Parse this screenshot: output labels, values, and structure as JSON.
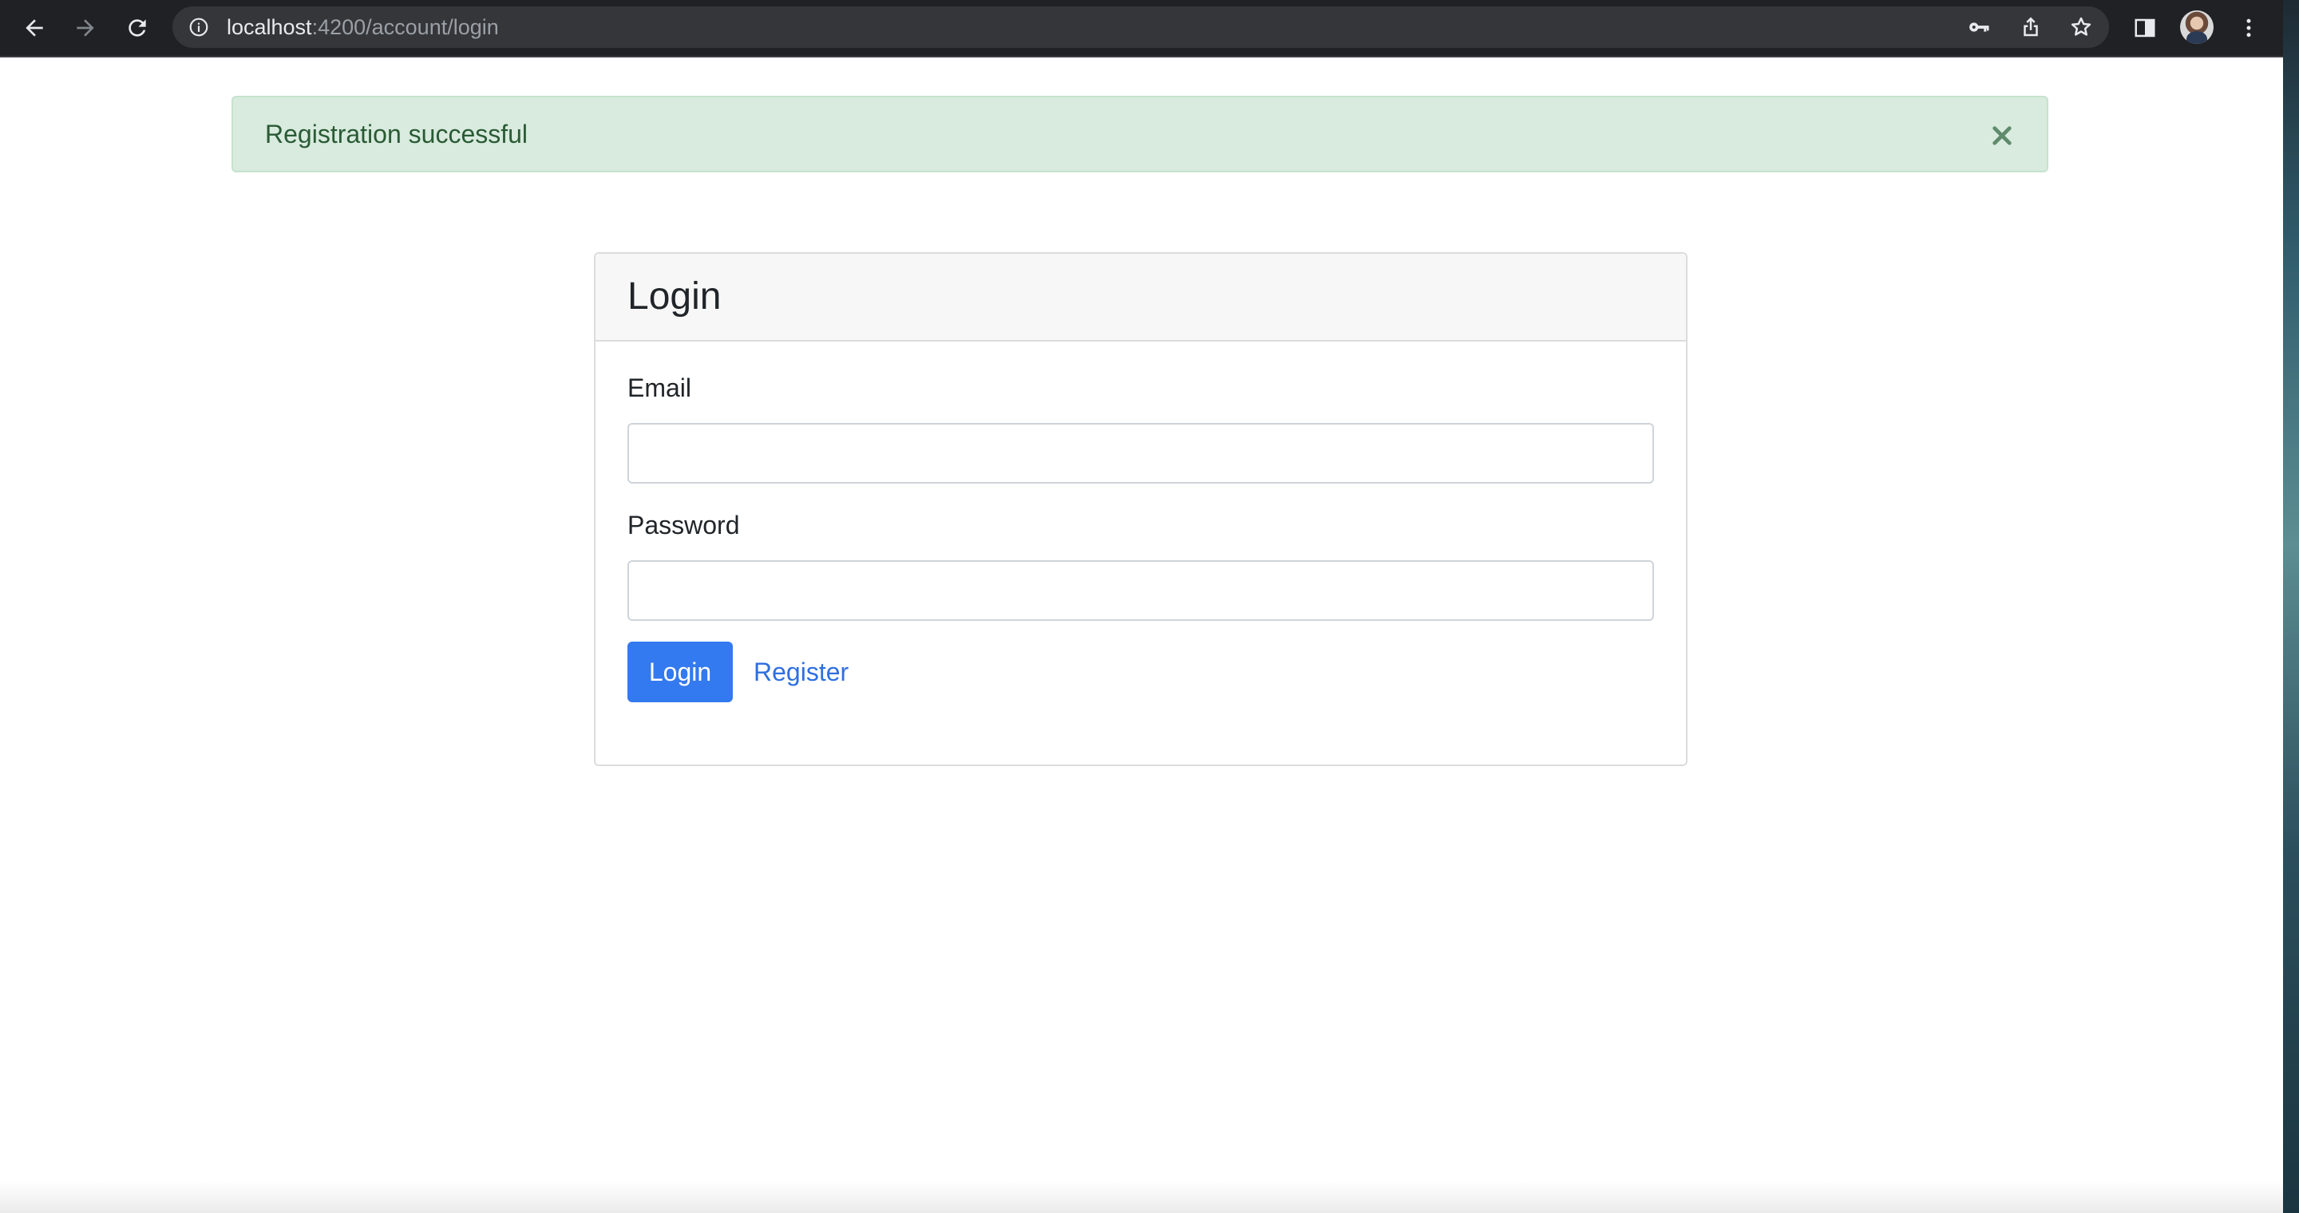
{
  "browser": {
    "url_host": "localhost",
    "url_path": ":4200/account/login",
    "icons": {
      "back": "arrow-left-icon",
      "forward": "arrow-right-icon",
      "reload": "reload-icon",
      "site_info": "info-icon",
      "password": "key-icon",
      "share": "share-icon",
      "bookmark": "star-icon",
      "side_panel": "side-panel-icon",
      "profile": "avatar",
      "menu": "kebab-menu-icon"
    }
  },
  "alert": {
    "message": "Registration successful",
    "close_label": "×",
    "color": "#d8ebde"
  },
  "login_form": {
    "title": "Login",
    "email_label": "Email",
    "email_value": "",
    "password_label": "Password",
    "password_value": "",
    "login_button": "Login",
    "register_link": "Register",
    "primary_color": "#3379f0"
  }
}
